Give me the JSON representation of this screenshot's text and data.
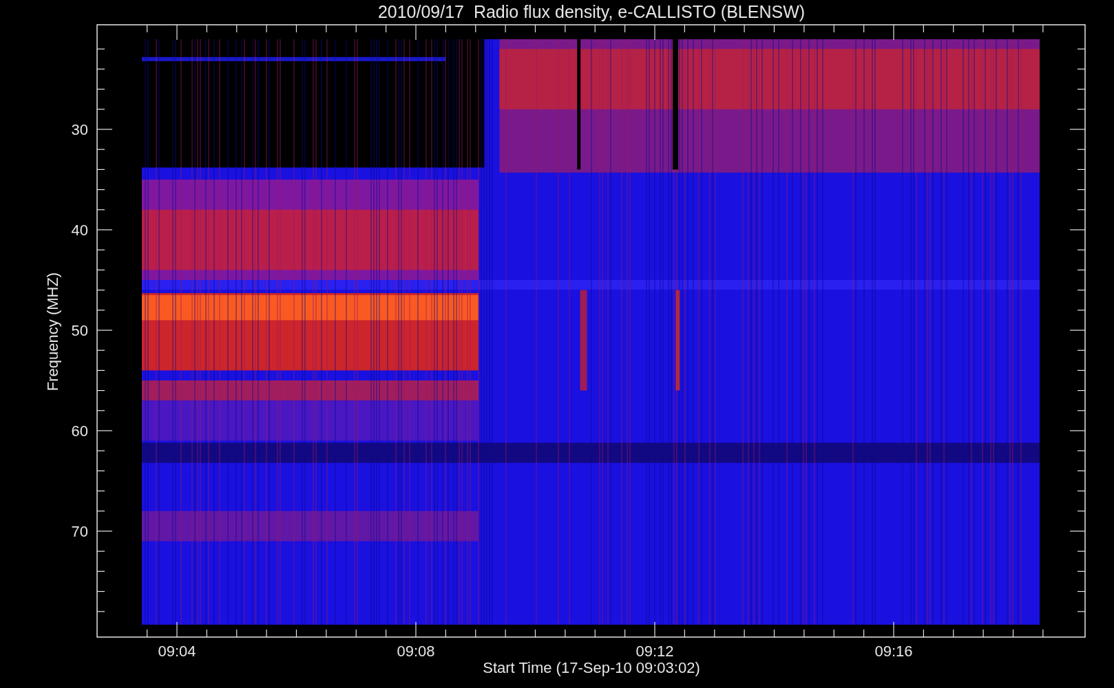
{
  "title": "2010/09/17  Radio flux density, e-CALLISTO (BLENSW)",
  "y_axis": {
    "label": "Frequency (MHZ)",
    "ticks": [
      "30",
      "40",
      "50",
      "60",
      "70"
    ]
  },
  "x_axis": {
    "label": "Start Time (17-Sep-10 09:03:02)",
    "ticks": [
      "09:04",
      "09:08",
      "09:12",
      "09:16"
    ]
  }
}
